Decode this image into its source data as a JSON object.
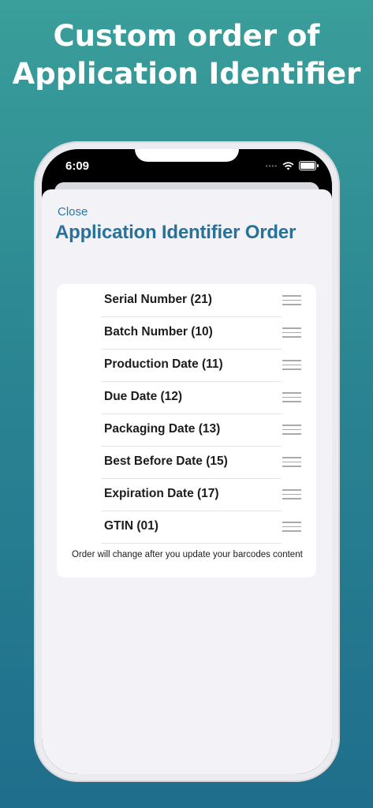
{
  "headline": {
    "line1": "Custom order of",
    "line2": "Application Identifier"
  },
  "status_bar": {
    "time": "6:09",
    "signal_dots": "••••"
  },
  "sheet": {
    "close_label": "Close",
    "title": "Application Identifier Order",
    "items": [
      {
        "label": "Serial Number (21)"
      },
      {
        "label": "Batch Number (10)"
      },
      {
        "label": "Production Date (11)"
      },
      {
        "label": "Due Date (12)"
      },
      {
        "label": "Packaging Date (13)"
      },
      {
        "label": "Best Before Date (15)"
      },
      {
        "label": "Expiration Date (17)"
      },
      {
        "label": "GTIN (01)"
      }
    ],
    "footer_note": "Order will change after you update your barcodes content"
  },
  "colors": {
    "background_top": "#3a9e9a",
    "background_bottom": "#1f6e8c",
    "accent": "#26729b"
  }
}
